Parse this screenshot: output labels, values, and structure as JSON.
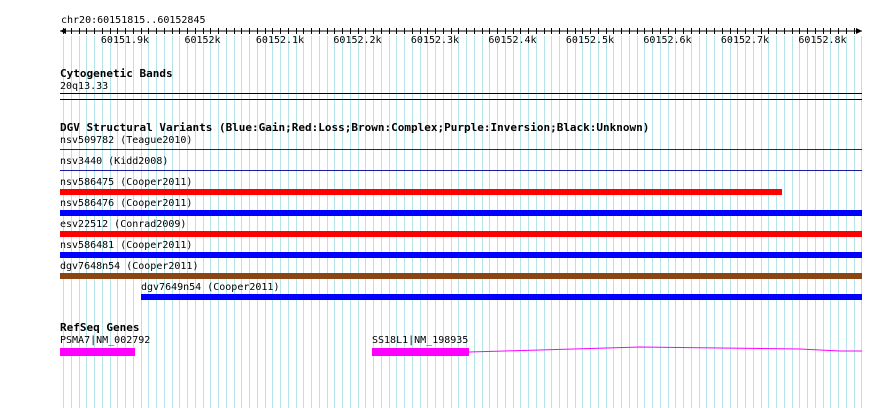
{
  "ruler": {
    "label": "chr20:60151815..60152845",
    "ticks": [
      "60151.9k",
      "60152k",
      "60152.1k",
      "60152.2k",
      "60152.3k",
      "60152.4k",
      "60152.5k",
      "60152.6k",
      "60152.7k",
      "60152.8k"
    ]
  },
  "cytobands": {
    "title": "Cytogenetic Bands",
    "band": "20q13.33"
  },
  "dgv": {
    "title": "DGV Structural Variants (Blue:Gain;Red:Loss;Brown:Complex;Purple:Inversion;Black:Unknown)",
    "tracks": [
      {
        "label": "nsv509782 (Teague2010)",
        "type": "line"
      },
      {
        "label": "nsv3440 (Kidd2008)",
        "type": "line"
      },
      {
        "label": "nsv586475 (Cooper2011)",
        "type": "Loss",
        "color": "#ff0000"
      },
      {
        "label": "nsv586476 (Cooper2011)",
        "type": "Gain",
        "color": "#0000ff"
      },
      {
        "label": "esv22512 (Conrad2009)",
        "type": "Loss",
        "color": "#ff0000"
      },
      {
        "label": "nsv586481 (Cooper2011)",
        "type": "Gain",
        "color": "#0000ff"
      },
      {
        "label": "dgv7648n54 (Cooper2011)",
        "type": "Complex",
        "color": "#8b4513"
      },
      {
        "label": "dgv7649n54 (Cooper2011)",
        "type": "Gain",
        "color": "#0000ff"
      }
    ]
  },
  "refseq": {
    "title": "RefSeq Genes",
    "genes": [
      {
        "label": "PSMA7|NM_002792",
        "color": "#ff00ff"
      },
      {
        "label": "SS18L1|NM_198935",
        "color": "#ff00ff"
      }
    ]
  }
}
